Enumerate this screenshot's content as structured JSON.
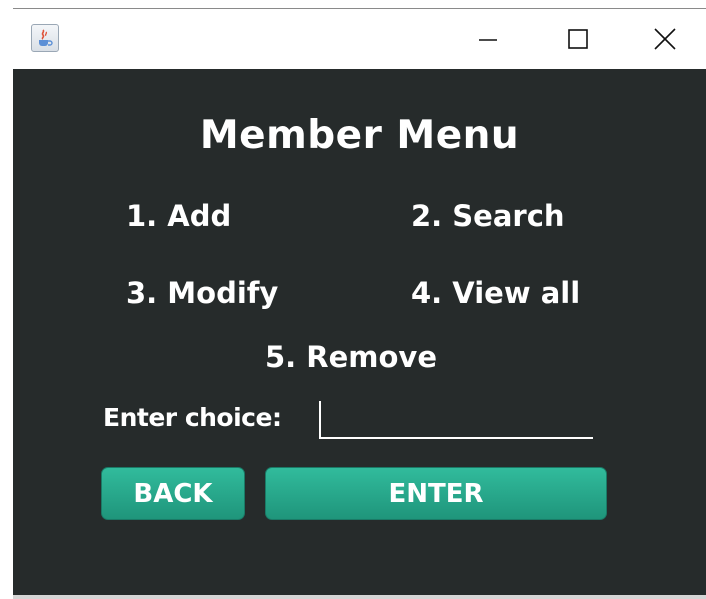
{
  "window": {
    "minimize_glyph": "—",
    "close_glyph": "✕"
  },
  "content": {
    "title": "Member Menu",
    "options": [
      {
        "label": "1. Add"
      },
      {
        "label": "2. Search"
      },
      {
        "label": "3. Modify"
      },
      {
        "label": "4. View all"
      },
      {
        "label": "5. Remove"
      }
    ],
    "choice_label": "Enter choice:",
    "choice_value": "",
    "back_label": "BACK",
    "enter_label": "ENTER"
  },
  "colors": {
    "background": "#262b2b",
    "button": "#27a88b",
    "text": "#ffffff"
  },
  "icons": {
    "app": "java-coffee-cup-icon",
    "minimize": "minimize-icon",
    "maximize": "maximize-icon",
    "close": "close-icon"
  }
}
